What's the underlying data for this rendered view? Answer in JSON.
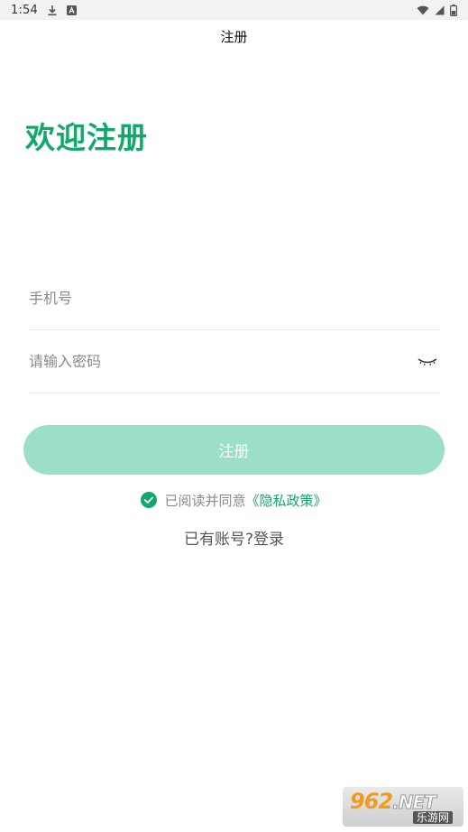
{
  "status_bar": {
    "time": "1:54",
    "left_icons": [
      "download-icon",
      "app-notification-icon"
    ],
    "right_icons": [
      "wifi-icon",
      "signal-icon",
      "battery-icon"
    ]
  },
  "header": {
    "title": "注册"
  },
  "welcome": {
    "heading": "欢迎注册"
  },
  "form": {
    "phone": {
      "placeholder": "手机号",
      "value": ""
    },
    "password": {
      "placeholder": "请输入密码",
      "value": "",
      "toggle_icon": "eye-closed-icon"
    }
  },
  "register_button": {
    "label": "注册"
  },
  "agreement": {
    "checked": true,
    "text": "已阅读并同意",
    "link_text": "《隐私政策》"
  },
  "login": {
    "text": "已有账号?登录"
  },
  "watermark": {
    "brand": "962",
    "suffix": ".NET",
    "subtitle": "乐游网"
  },
  "colors": {
    "accent": "#12a86a",
    "button_disabled": "#9be0c6",
    "placeholder": "#8a8a8a",
    "divider": "#ececec"
  }
}
